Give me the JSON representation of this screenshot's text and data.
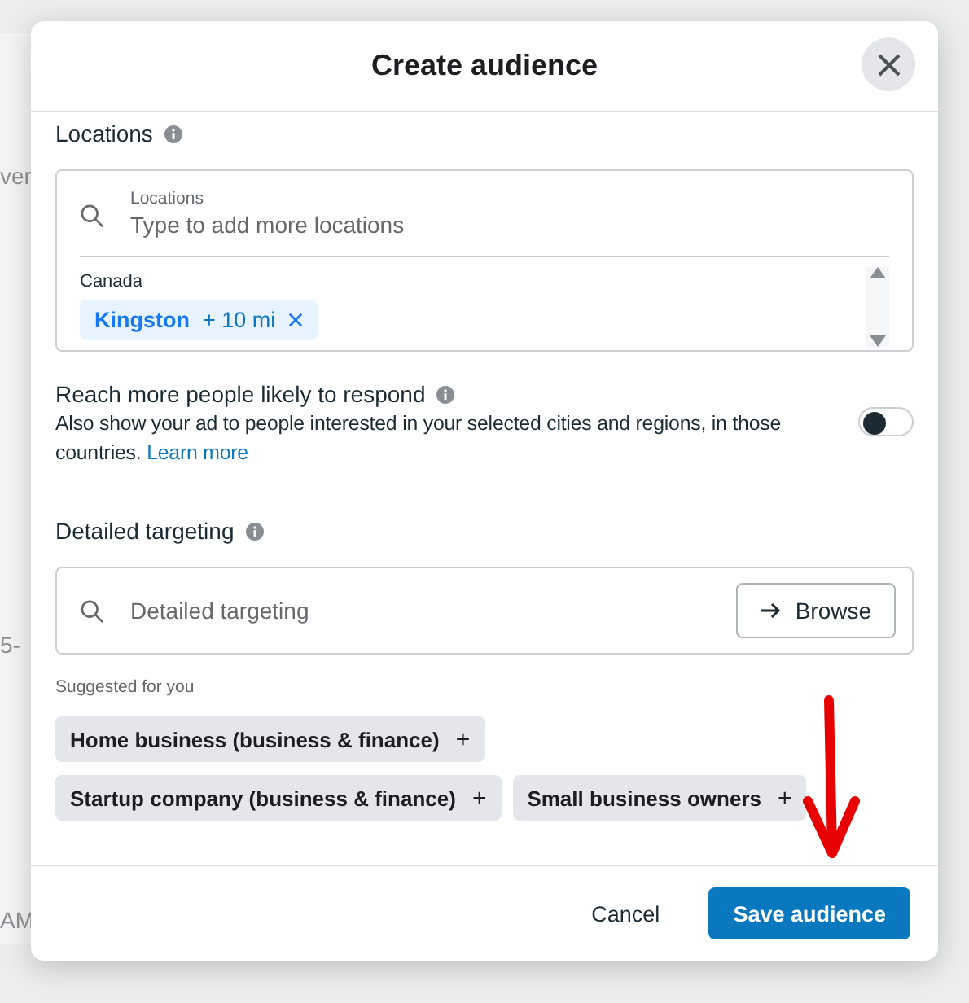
{
  "background": {
    "texts": [
      "ver",
      "5-",
      "AM"
    ]
  },
  "dialog": {
    "title": "Create audience"
  },
  "locations": {
    "label": "Locations",
    "field_label": "Locations",
    "placeholder": "Type to add more locations",
    "group": "Canada",
    "tags": [
      {
        "name": "Kingston",
        "radius": "+ 10 mi"
      }
    ]
  },
  "reach": {
    "title": "Reach more people likely to respond",
    "description": "Also show your ad to people interested in your selected cities and regions, in those countries.",
    "link": "Learn more",
    "on": false
  },
  "detailed_targeting": {
    "label": "Detailed targeting",
    "placeholder": "Detailed targeting",
    "browse": "Browse",
    "suggested_label": "Suggested for you",
    "suggestions": [
      {
        "label": "Home business (business & finance)",
        "icon": "+"
      },
      {
        "label": "Startup company (business & finance)",
        "icon": "+"
      },
      {
        "label": "Small business owners",
        "icon": "+"
      }
    ]
  },
  "footer": {
    "cancel": "Cancel",
    "save": "Save audience"
  }
}
